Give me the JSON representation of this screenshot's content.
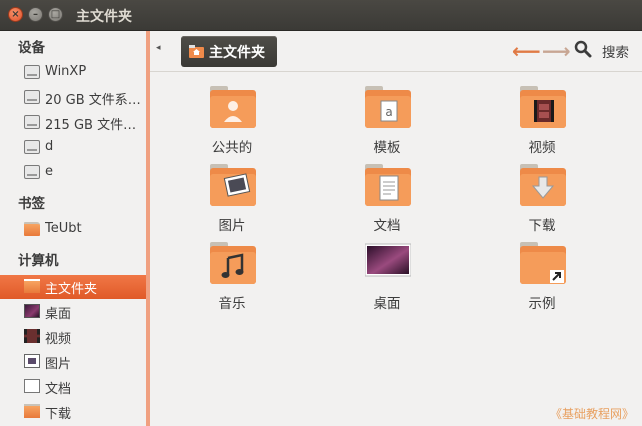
{
  "window": {
    "title": "主文件夹"
  },
  "sidebar": {
    "devices_heading": "设备",
    "devices": [
      {
        "label": "WinXP"
      },
      {
        "label": "20 GB 文件系…"
      },
      {
        "label": "215 GB 文件…"
      },
      {
        "label": "d"
      },
      {
        "label": "e"
      }
    ],
    "bookmarks_heading": "书签",
    "bookmarks": [
      {
        "label": "TeUbt"
      }
    ],
    "computer_heading": "计算机",
    "computer": [
      {
        "label": "主文件夹",
        "selected": true
      },
      {
        "label": "桌面"
      },
      {
        "label": "视频"
      },
      {
        "label": "图片"
      },
      {
        "label": "文档"
      },
      {
        "label": "下载"
      }
    ]
  },
  "toolbar": {
    "breadcrumb": "主文件夹",
    "search_label": "搜索"
  },
  "files": [
    {
      "label": "公共的",
      "icon": "public-folder-icon"
    },
    {
      "label": "模板",
      "icon": "templates-folder-icon"
    },
    {
      "label": "视频",
      "icon": "videos-folder-icon"
    },
    {
      "label": "图片",
      "icon": "pictures-folder-icon"
    },
    {
      "label": "文档",
      "icon": "documents-folder-icon"
    },
    {
      "label": "下载",
      "icon": "downloads-folder-icon"
    },
    {
      "label": "音乐",
      "icon": "music-folder-icon"
    },
    {
      "label": "桌面",
      "icon": "desktop-icon"
    },
    {
      "label": "示例",
      "icon": "examples-folder-icon"
    }
  ],
  "watermark": "《基础教程网》",
  "colors": {
    "accent": "#e8612c",
    "folder": "#f09050",
    "titlebar": "#3c3b37"
  }
}
